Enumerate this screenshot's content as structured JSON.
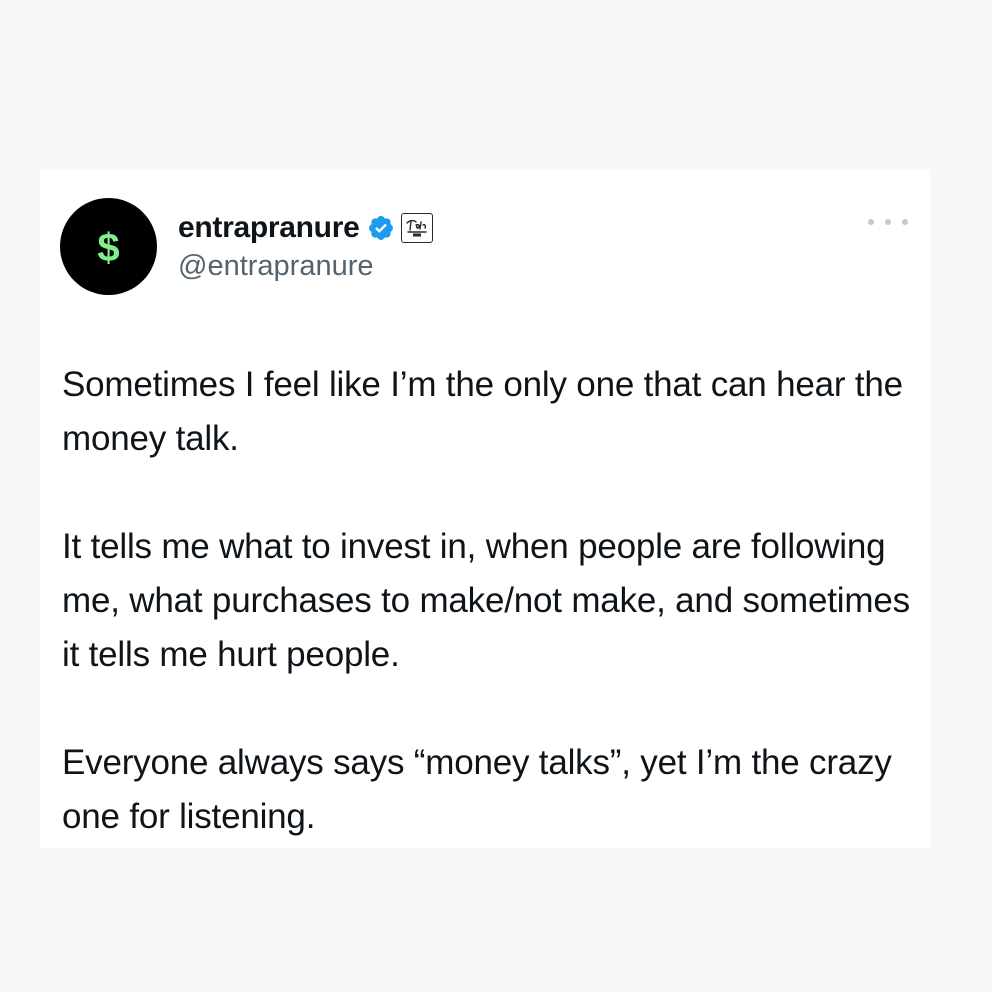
{
  "author": {
    "display_name": "entrapranure",
    "handle": "@entrapranure",
    "avatar_glyph": "$",
    "avatar_bg": "#000000",
    "avatar_glyph_color": "#7ff08a",
    "verified_badge_color": "#1d9bf0",
    "affiliate_badge_icon": "affiliate-logo-icon"
  },
  "menu": {
    "more_icon": "more-horizontal-icon"
  },
  "tweet": {
    "paragraphs": [
      "Sometimes I feel like I’m the only one that can hear the money talk.",
      "It tells me what to invest in, when people are following me, what purchases to make/not make, and sometimes it tells me hurt people.",
      "Everyone always says “money talks”, yet I’m the crazy one for listening."
    ]
  }
}
